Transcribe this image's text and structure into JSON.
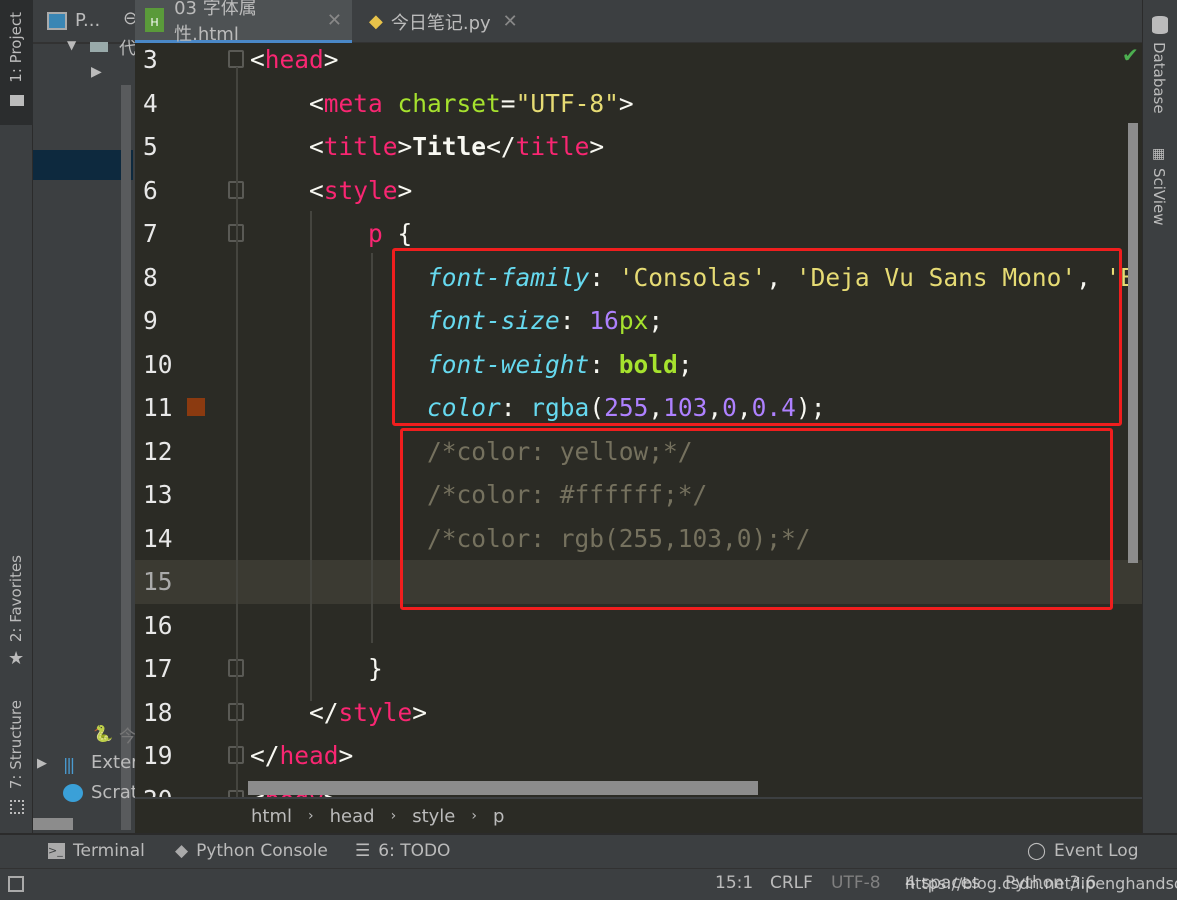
{
  "left_strip": {
    "project": "1: Project",
    "favorites": "2: Favorites",
    "structure": "7: Structure"
  },
  "project_panel": {
    "selector": "P...",
    "items": [
      "代",
      "今",
      "Exter",
      "Scrat"
    ]
  },
  "tabs": [
    {
      "label": "03 字体属性.html",
      "icon": "html-file-icon",
      "active": true
    },
    {
      "label": "今日笔记.py",
      "icon": "python-file-icon",
      "active": false
    }
  ],
  "editor": {
    "lines": [
      {
        "n": "3",
        "tokens": [
          [
            "<",
            "t-br"
          ],
          [
            "head",
            "t-tag"
          ],
          [
            ">",
            "t-br"
          ]
        ]
      },
      {
        "n": "4",
        "tokens": [
          [
            "    <",
            "t-br"
          ],
          [
            "meta",
            "t-tag"
          ],
          [
            " charset",
            "t-attr"
          ],
          [
            "=",
            "t-br"
          ],
          [
            "\"UTF-8\"",
            "t-str"
          ],
          [
            ">",
            "t-br"
          ]
        ]
      },
      {
        "n": "5",
        "tokens": [
          [
            "    <",
            "t-br"
          ],
          [
            "title",
            "t-tag"
          ],
          [
            ">",
            "t-br"
          ],
          [
            "Title",
            "t-txt"
          ],
          [
            "</",
            "t-br"
          ],
          [
            "title",
            "t-tag"
          ],
          [
            ">",
            "t-br"
          ]
        ]
      },
      {
        "n": "6",
        "tokens": [
          [
            "    <",
            "t-br"
          ],
          [
            "style",
            "t-tag"
          ],
          [
            ">",
            "t-br"
          ]
        ]
      },
      {
        "n": "7",
        "tokens": [
          [
            "        ",
            "t-p"
          ],
          [
            "p",
            "t-sel"
          ],
          [
            " {",
            "t-p"
          ]
        ]
      },
      {
        "n": "8",
        "tokens": [
          [
            "            ",
            "t-p"
          ],
          [
            "font-family",
            "t-prop"
          ],
          [
            ": ",
            "t-p"
          ],
          [
            "'Consolas'",
            "t-str"
          ],
          [
            ", ",
            "t-p"
          ],
          [
            "'Deja Vu Sans Mono'",
            "t-str"
          ],
          [
            ", ",
            "t-p"
          ],
          [
            "'B",
            "t-str"
          ]
        ]
      },
      {
        "n": "9",
        "tokens": [
          [
            "            ",
            "t-p"
          ],
          [
            "font-size",
            "t-prop"
          ],
          [
            ": ",
            "t-p"
          ],
          [
            "16",
            "t-num"
          ],
          [
            "px",
            "t-unit"
          ],
          [
            ";",
            "t-p"
          ]
        ]
      },
      {
        "n": "10",
        "tokens": [
          [
            "            ",
            "t-p"
          ],
          [
            "font-weight",
            "t-prop"
          ],
          [
            ": ",
            "t-p"
          ],
          [
            "bold",
            "t-kw"
          ],
          [
            ";",
            "t-p"
          ]
        ]
      },
      {
        "n": "11",
        "tokens": [
          [
            "            ",
            "t-p"
          ],
          [
            "color",
            "t-prop"
          ],
          [
            ": ",
            "t-p"
          ],
          [
            "rgba",
            "t-fn"
          ],
          [
            "(",
            "t-p"
          ],
          [
            "255",
            "t-num"
          ],
          [
            ",",
            "t-p"
          ],
          [
            "103",
            "t-num"
          ],
          [
            ",",
            "t-p"
          ],
          [
            "0",
            "t-num"
          ],
          [
            ",",
            "t-p"
          ],
          [
            "0.4",
            "t-num"
          ],
          [
            ");",
            "t-p"
          ]
        ]
      },
      {
        "n": "12",
        "tokens": [
          [
            "            /*color: yellow;*/",
            "t-com"
          ]
        ]
      },
      {
        "n": "13",
        "tokens": [
          [
            "            /*color: #ffffff;*/",
            "t-com"
          ]
        ]
      },
      {
        "n": "14",
        "tokens": [
          [
            "            /*color: rgb(255,103,0);*/",
            "t-com"
          ]
        ]
      },
      {
        "n": "15",
        "tokens": [],
        "current": true
      },
      {
        "n": "16",
        "tokens": []
      },
      {
        "n": "17",
        "tokens": [
          [
            "        }",
            "t-p"
          ]
        ]
      },
      {
        "n": "18",
        "tokens": [
          [
            "    </",
            "t-br"
          ],
          [
            "style",
            "t-tag"
          ],
          [
            ">",
            "t-br"
          ]
        ]
      },
      {
        "n": "19",
        "tokens": [
          [
            "</",
            "t-br"
          ],
          [
            "head",
            "t-tag"
          ],
          [
            ">",
            "t-br"
          ]
        ]
      },
      {
        "n": "20",
        "tokens": [
          [
            "<",
            "t-br"
          ],
          [
            "body",
            "t-tag"
          ],
          [
            ">",
            "t-br"
          ]
        ]
      }
    ],
    "color_swatch": "#8b3a10",
    "inspection": "ok-check-icon"
  },
  "breadcrumb": [
    "html",
    "head",
    "style",
    "p"
  ],
  "right_strip": {
    "database": "Database",
    "sciview": "SciView"
  },
  "tool_windows": {
    "terminal": "Terminal",
    "python_console": "Python Console",
    "todo": "6: TODO",
    "event_log": "Event Log"
  },
  "status": {
    "position": "15:1",
    "line_sep": "CRLF",
    "encoding": "UTF-8",
    "indent": "4 spaces",
    "interpreter": "Python 3.6",
    "watermark": "https://blog.csdn.net/lipenghandsome"
  },
  "colors": {
    "accent": "#4a88c7",
    "highlight_box": "#f01e1e",
    "editor_bg": "#2b2b25"
  }
}
